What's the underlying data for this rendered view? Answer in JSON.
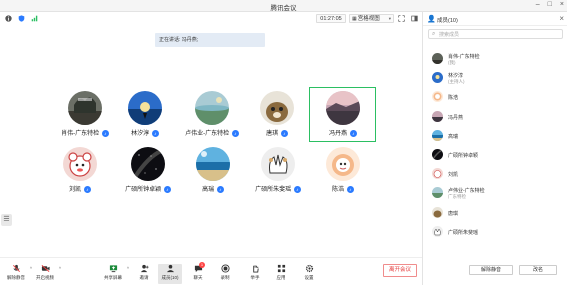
{
  "window": {
    "title": "腾讯会议"
  },
  "topbar": {
    "timer": "01:27:05",
    "view_mode": "宫格视图"
  },
  "stage": {
    "speaker_text": "正在讲话: 冯丹燕;",
    "participants": [
      {
        "name": "肖伟-广东特检"
      },
      {
        "name": "林汐淳"
      },
      {
        "name": "卢伟业-广东特检"
      },
      {
        "name": "唐琪"
      },
      {
        "name": "冯丹燕"
      },
      {
        "name": "刘凯"
      },
      {
        "name": "广硕所钟卓颖"
      },
      {
        "name": "高瑞"
      },
      {
        "name": "广硕所朱斐瑶"
      },
      {
        "name": "陈浩"
      }
    ]
  },
  "panel": {
    "title": "成员(10)",
    "search_placeholder": "搜索成员",
    "members": [
      {
        "name": "肖伟-广东特检",
        "sub": "(我)"
      },
      {
        "name": "林汐淳",
        "sub": "(主持人)"
      },
      {
        "name": "陈浩"
      },
      {
        "name": "冯丹燕"
      },
      {
        "name": "高瑞"
      },
      {
        "name": "广硕所钟卓颖"
      },
      {
        "name": "刘凯"
      },
      {
        "name": "卢伟业-广东特检",
        "sub": "广东特检"
      },
      {
        "name": "唐琪"
      },
      {
        "name": "广硕所朱斐瑶"
      }
    ],
    "unmute_all": "解除静音",
    "rename": "改名"
  },
  "bottombar": {
    "mute": "解除静音",
    "video": "开启视频",
    "share": "共享屏幕",
    "invite": "邀请",
    "members": "成员(10)",
    "chat": "聊天",
    "chat_badge": "1",
    "record": "录制",
    "raise_hand": "举手",
    "apps": "应用",
    "settings": "设置",
    "leave": "离开会议"
  },
  "colors": {
    "accent": "#2b7bff",
    "active_border": "#2bbf62",
    "leave": "#e53a3a"
  }
}
